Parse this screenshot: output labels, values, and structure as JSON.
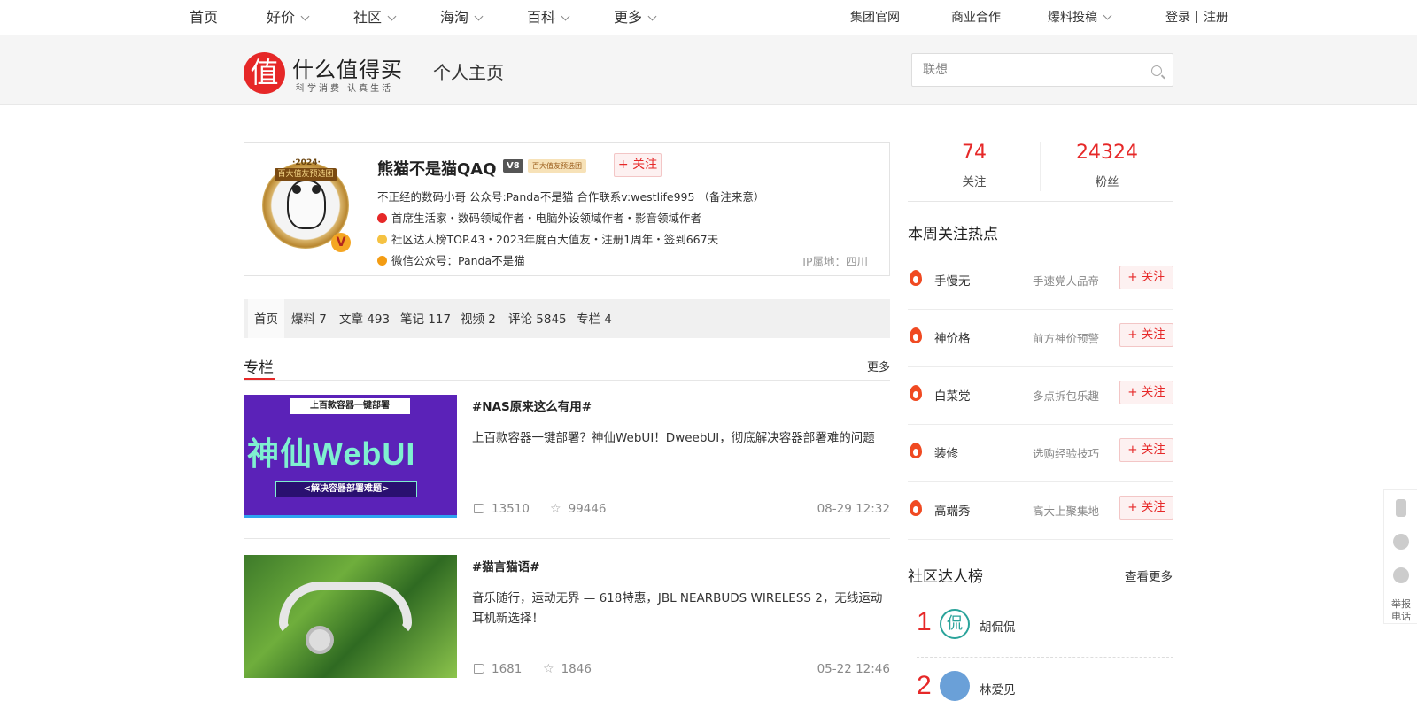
{
  "topnav": {
    "left": [
      "首页",
      "好价",
      "社区",
      "海淘",
      "百科",
      "更多"
    ],
    "right": {
      "group": "集团官网",
      "biz": "商业合作",
      "submit": "爆料投稿",
      "login": "登录",
      "register": "注册"
    }
  },
  "header": {
    "logo_char": "值",
    "logo_text": "什么值得买",
    "logo_slogan": "科学消费 认真生活",
    "page_title": "个人主页",
    "search_placeholder": "联想"
  },
  "profile": {
    "badge_year": "·2024·",
    "badge_ribbon": "百大值友预选团",
    "badge_v": "V",
    "name": "熊猫不是猫QAQ",
    "level": "V8",
    "tag": "百大值友预选团",
    "follow": "+ 关注",
    "bio": "不正经的数码小哥 公众号:Panda不是猫 合作联系v:westlife995 （备注来意）",
    "roles": "首席生活家・数码领域作者・电脑外设领域作者・影音领域作者",
    "ranks": "社区达人榜TOP.43・2023年度百大值友・注册1周年・签到667天",
    "wechat": "微信公众号：Panda不是猫",
    "ip": "IP属地：四川"
  },
  "tabs": [
    {
      "label": "首页"
    },
    {
      "label": "爆料 7"
    },
    {
      "label": "文章 493"
    },
    {
      "label": "笔记 117"
    },
    {
      "label": "视频 2"
    },
    {
      "label": "评论 5845"
    },
    {
      "label": "专栏 4"
    }
  ],
  "section": {
    "title": "专栏",
    "more": "更多"
  },
  "articles": [
    {
      "tag": "#NAS原来这么有用#",
      "desc": "上百款容器一键部署？神仙WebUI！DweebUI，彻底解决容器部署难的问题",
      "likes": "13510",
      "stars": "99446",
      "date": "08-29 12:32",
      "thumb_top": "上百款容器一键部署",
      "thumb_main": "神仙WebUI",
      "thumb_bottom": "<解决容器部署难题>"
    },
    {
      "tag": "#猫言猫语#",
      "desc": "音乐随行，运动无界 — 618特惠，JBL NEARBUDS WIRELESS 2，无线运动耳机新选择！",
      "likes": "1681",
      "stars": "1846",
      "date": "05-22 12:46"
    }
  ],
  "stats": {
    "following": "74",
    "following_label": "关注",
    "fans": "24324",
    "fans_label": "粉丝"
  },
  "hot": {
    "title": "本周关注热点",
    "follow": "+ 关注",
    "items": [
      {
        "name": "手慢无",
        "desc": "手速党人品帝"
      },
      {
        "name": "神价格",
        "desc": "前方神价预警"
      },
      {
        "name": "白菜党",
        "desc": "多点拆包乐趣"
      },
      {
        "name": "装修",
        "desc": "选购经验技巧"
      },
      {
        "name": "高端秀",
        "desc": "高大上聚集地"
      }
    ]
  },
  "ranking": {
    "title": "社区达人榜",
    "more": "查看更多",
    "items": [
      {
        "rank": "1",
        "avatar": "侃",
        "name": "胡侃侃"
      },
      {
        "rank": "2",
        "avatar": "",
        "name": "林爱见"
      }
    ]
  },
  "float": {
    "report": "举报电话"
  }
}
